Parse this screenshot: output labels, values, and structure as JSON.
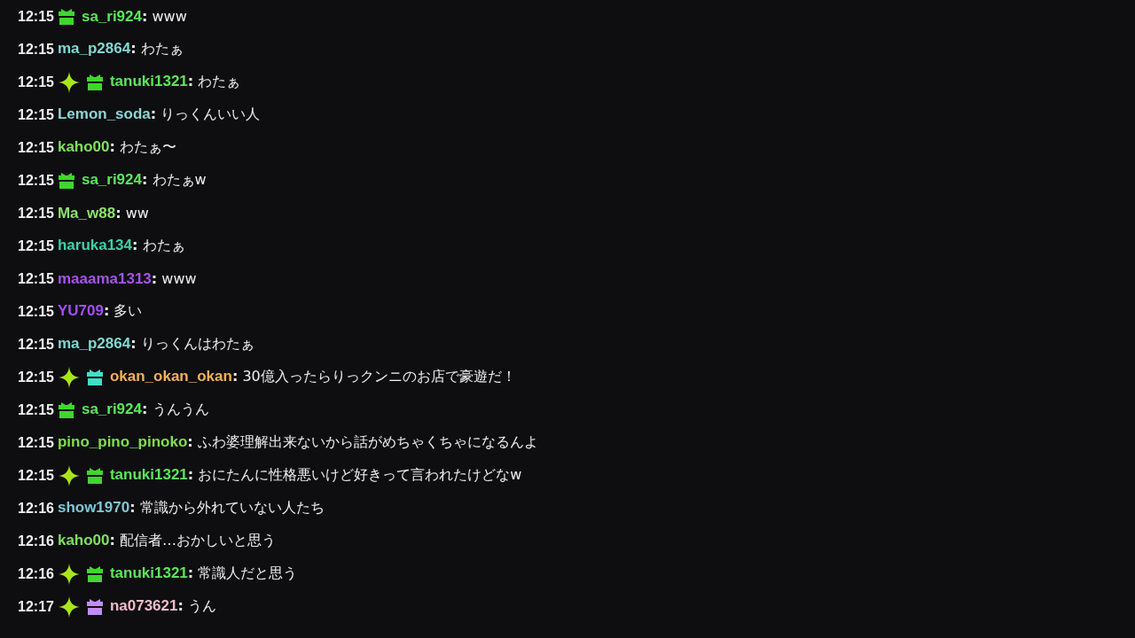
{
  "messages": [
    {
      "time": "12:15",
      "badges": [
        {
          "kind": "gift",
          "color": "#3fd62e"
        }
      ],
      "user": "sa_ri924",
      "color": "#5ce65c",
      "separator": ":",
      "text": "www"
    },
    {
      "time": "12:15",
      "user": "ma_p2864",
      "color": "#7fd8d0",
      "separator": ":",
      "text": "わたぁ"
    },
    {
      "time": "12:15",
      "badges": [
        {
          "kind": "sparkle",
          "color": "#a8e61a"
        },
        {
          "kind": "gift",
          "color": "#3fd62e"
        }
      ],
      "user": "tanuki1321",
      "color": "#5ce65c",
      "separator": ":",
      "text": "わたぁ"
    },
    {
      "time": "12:15",
      "user": "Lemon_soda",
      "color": "#8ed6d6",
      "separator": ":",
      "text": "りっくんいい人"
    },
    {
      "time": "12:15",
      "user": "kaho00",
      "color": "#7fe05e",
      "separator": ":",
      "text": "わたぁ〜"
    },
    {
      "time": "12:15",
      "badges": [
        {
          "kind": "gift",
          "color": "#3fd62e"
        }
      ],
      "user": "sa_ri924",
      "color": "#5ce65c",
      "separator": ":",
      "text": "わたぁw"
    },
    {
      "time": "12:15",
      "user": "Ma_w88",
      "color": "#8fe06e",
      "separator": ":",
      "text": "ww"
    },
    {
      "time": "12:15",
      "user": "haruka134",
      "color": "#3ad1a6",
      "separator": ":",
      "text": "わたぁ"
    },
    {
      "time": "12:15",
      "user": "maaama1313",
      "color": "#a653e8",
      "separator": ":",
      "text": "www"
    },
    {
      "time": "12:15",
      "user": "YU709",
      "color": "#a050f0",
      "separator": ":",
      "text": "多い"
    },
    {
      "time": "12:15",
      "user": "ma_p2864",
      "color": "#7fd8d0",
      "separator": ":",
      "text": "りっくんはわたぁ"
    },
    {
      "time": "12:15",
      "badges": [
        {
          "kind": "sparkle",
          "color": "#a8e61a"
        },
        {
          "kind": "gift",
          "color": "#3fe0c8"
        }
      ],
      "user": "okan_okan_okan",
      "color": "#f2b25a",
      "separator": ":",
      "text": "30億入ったらりっクンニのお店で豪遊だ！"
    },
    {
      "time": "12:15",
      "badges": [
        {
          "kind": "gift",
          "color": "#3fd62e"
        }
      ],
      "user": "sa_ri924",
      "color": "#5ce65c",
      "separator": ":",
      "text": "うんうん"
    },
    {
      "time": "12:15",
      "user": "pino_pino_pinoko",
      "color": "#7ee04a",
      "separator": ":",
      "text": "ふわ婆理解出来ないから話がめちゃくちゃになるんよ"
    },
    {
      "time": "12:15",
      "badges": [
        {
          "kind": "sparkle",
          "color": "#a8e61a"
        },
        {
          "kind": "gift",
          "color": "#3fd62e"
        }
      ],
      "user": "tanuki1321",
      "color": "#5ce65c",
      "separator": ":",
      "text": "おにたんに性格悪いけど好きって言われたけどなw"
    },
    {
      "time": "12:16",
      "user": "show1970",
      "color": "#7fc8d8",
      "separator": ":",
      "text": "常識から外れていない人たち"
    },
    {
      "time": "12:16",
      "user": "kaho00",
      "color": "#7fe05e",
      "separator": ":",
      "text": "配信者…おかしいと思う"
    },
    {
      "time": "12:16",
      "badges": [
        {
          "kind": "sparkle",
          "color": "#a8e61a"
        },
        {
          "kind": "gift",
          "color": "#3fd62e"
        }
      ],
      "user": "tanuki1321",
      "color": "#5ce65c",
      "separator": ":",
      "text": "常識人だと思う"
    },
    {
      "time": "12:17",
      "badges": [
        {
          "kind": "sparkle",
          "color": "#a8e61a"
        },
        {
          "kind": "gift",
          "color": "#c08ef0"
        }
      ],
      "user": "na073621",
      "color": "#f0bccb",
      "separator": ":",
      "text": "うん"
    }
  ]
}
